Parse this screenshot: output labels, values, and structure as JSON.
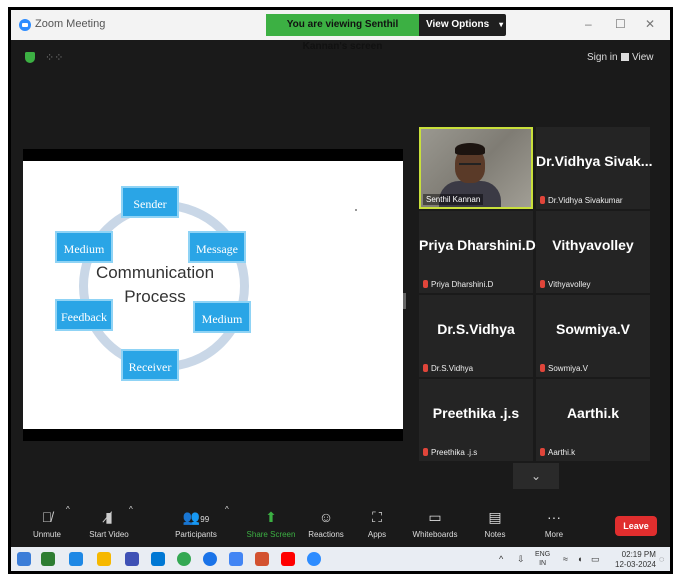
{
  "window": {
    "title": "Zoom Meeting",
    "share_banner": "You are viewing Senthil Kannan's screen",
    "view_options": "View Options",
    "minimize": "–",
    "maximize": "☐",
    "close": "✕"
  },
  "topbar": {
    "sign_in": "Sign in",
    "view": "View"
  },
  "slide": {
    "title_line1": "Communication",
    "title_line2": "Process",
    "nodes": {
      "sender": "Sender",
      "message": "Message",
      "medium_right": "Medium",
      "receiver": "Receiver",
      "feedback": "Feedback",
      "medium_left": "Medium"
    }
  },
  "gallery": {
    "video_tile": {
      "name": "Senthil Kannan"
    },
    "tiles": [
      {
        "display": "Dr.Vidhya  Sivak...",
        "label": "Dr.Vidhya Sivakumar"
      },
      {
        "display": "Priya Dharshini.D",
        "label": "Priya Dharshini.D"
      },
      {
        "display": "Vithyavolley",
        "label": "Vithyavolley"
      },
      {
        "display": "Dr.S.Vidhya",
        "label": "Dr.S.Vidhya"
      },
      {
        "display": "Sowmiya.V",
        "label": "Sowmiya.V"
      },
      {
        "display": "Preethika .j.s",
        "label": "Preethika .j.s"
      },
      {
        "display": "Aarthi.k",
        "label": "Aarthi.k"
      }
    ]
  },
  "toolbar": {
    "unmute": "Unmute",
    "start_video": "Start Video",
    "participants": "Participants",
    "participants_count": "99",
    "share_screen": "Share Screen",
    "reactions": "Reactions",
    "apps": "Apps",
    "whiteboards": "Whiteboards",
    "notes": "Notes",
    "more": "More",
    "leave": "Leave"
  },
  "taskbar": {
    "lang_top": "ENG",
    "lang_bottom": "IN",
    "time": "02:19 PM",
    "date": "12-03-2024"
  },
  "colors": {
    "accent_green": "#3cb043",
    "leave_red": "#e02e2e",
    "node_blue": "#2aa5e6",
    "speaker_border": "#c9e03b"
  },
  "icons": [
    "zoom-logo-icon",
    "shield-icon",
    "grid-icon",
    "view-icon",
    "chevron-down-icon",
    "mic-muted-icon",
    "video-off-icon",
    "participants-icon",
    "share-screen-icon",
    "reactions-icon",
    "apps-icon",
    "whiteboard-icon",
    "notes-icon",
    "more-icon"
  ]
}
